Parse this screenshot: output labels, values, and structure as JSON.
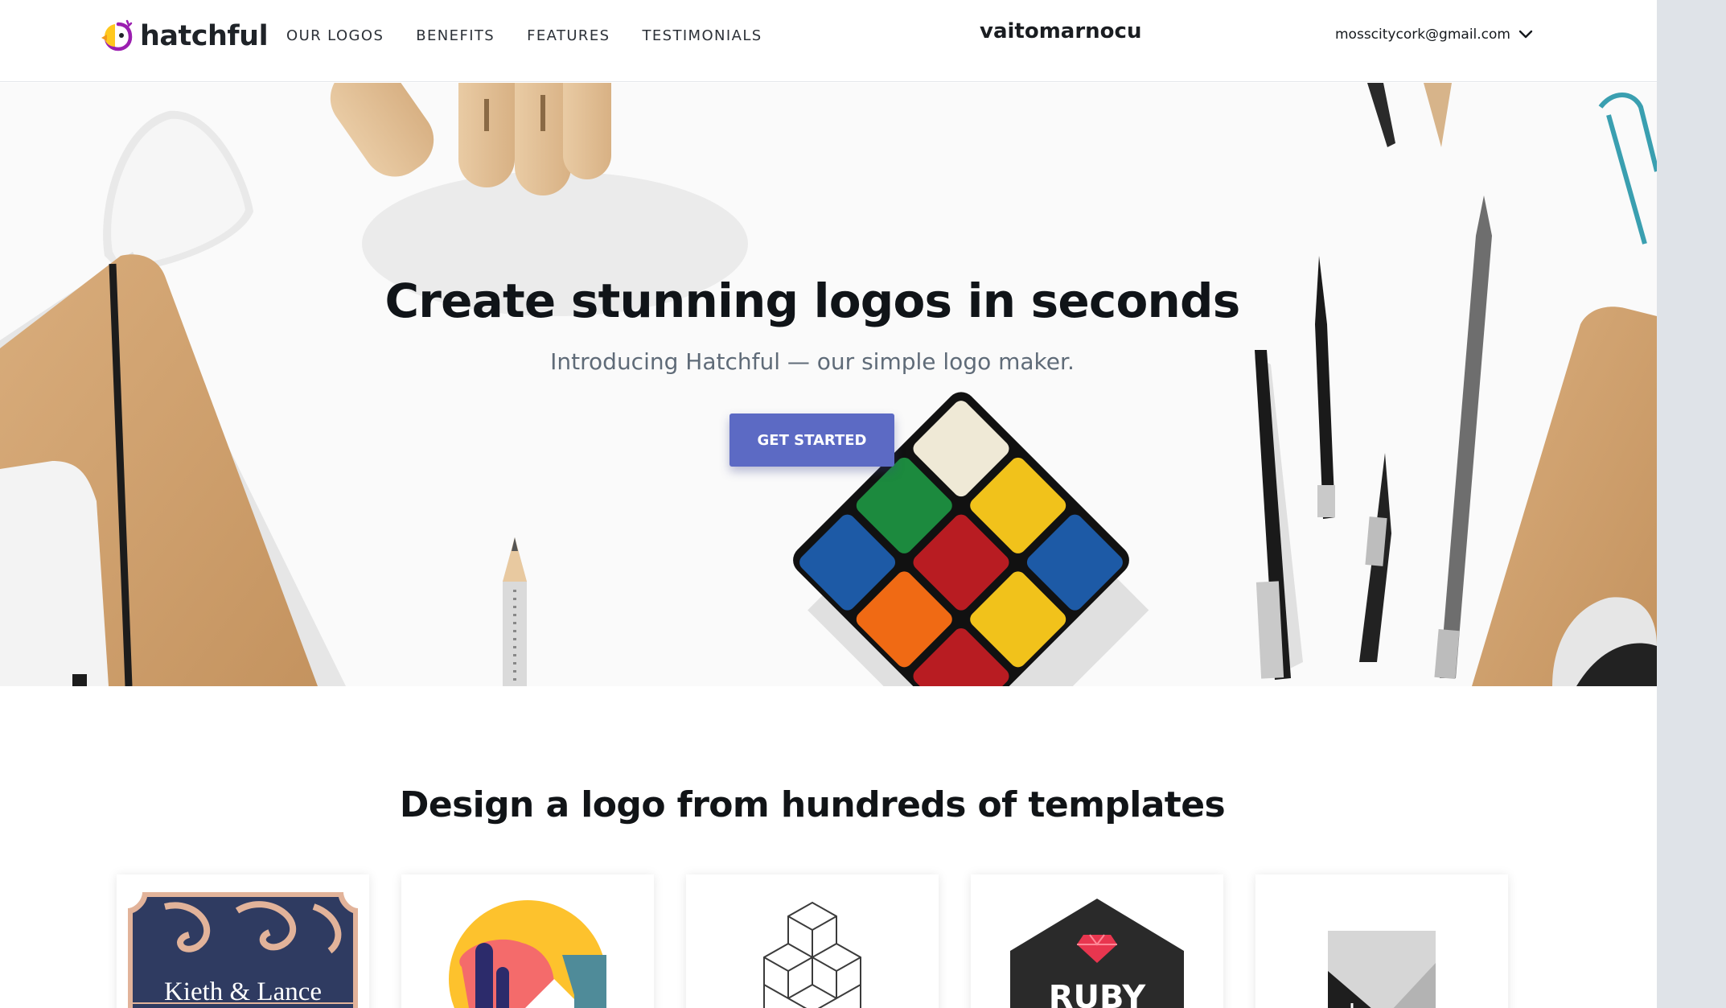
{
  "header": {
    "brand_name": "hatchful",
    "nav": [
      "OUR LOGOS",
      "BENEFITS",
      "FEATURES",
      "TESTIMONIALS"
    ],
    "store_name": "vaitomarnocu",
    "account_email": "mosscitycork@gmail.com"
  },
  "hero": {
    "title": "Create stunning logos in seconds",
    "subtitle": "Introducing Hatchful — our simple logo maker.",
    "cta_label": "GET STARTED"
  },
  "templates": {
    "title": "Design a logo from hundreds of templates",
    "cards": [
      {
        "text": "Kieth & Lance",
        "icon": "ornament-badge-logo"
      },
      {
        "text": "",
        "icon": "circle-house-logo"
      },
      {
        "text": "",
        "icon": "isometric-cubes-logo"
      },
      {
        "text": "RUBY",
        "icon": "ruby-gem-logo"
      },
      {
        "text": "",
        "icon": "geometric-stripes-logo"
      }
    ]
  },
  "colors": {
    "accent": "#5c6ac4",
    "brand_yellow": "#ffc81e",
    "brand_purple": "#9b1fb0",
    "gutter": "#dfe3e8"
  }
}
